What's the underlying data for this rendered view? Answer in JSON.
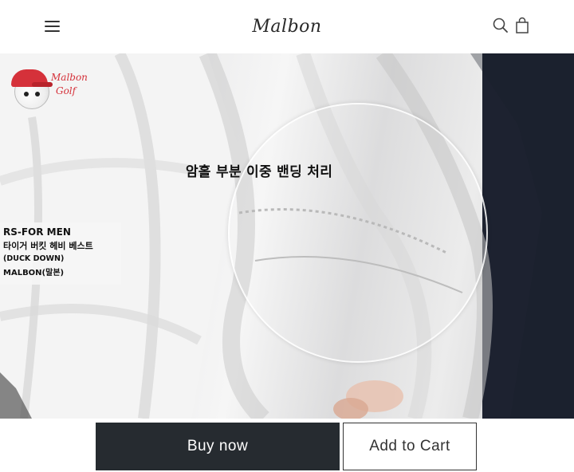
{
  "header": {
    "logo_text": "Malbon",
    "menu_icon": "hamburger-menu-icon",
    "search_icon": "search-icon",
    "cart_icon": "shopping-bag-icon"
  },
  "hero": {
    "badge_text_line1": "Malbon",
    "badge_text_line2": "Golf",
    "callout": "암홀 부분 이중 밴딩 처리",
    "product_label": {
      "line1": "RS-FOR MEN",
      "line2": "타이거 버킷 헤비 베스트",
      "line3": "(DUCK DOWN)",
      "line4": "MALBON(말본)"
    }
  },
  "actions": {
    "buy_now": "Buy now",
    "add_to_cart": "Add to Cart"
  },
  "colors": {
    "buy_button_bg": "#262b30",
    "brand_red": "#d5313a"
  }
}
